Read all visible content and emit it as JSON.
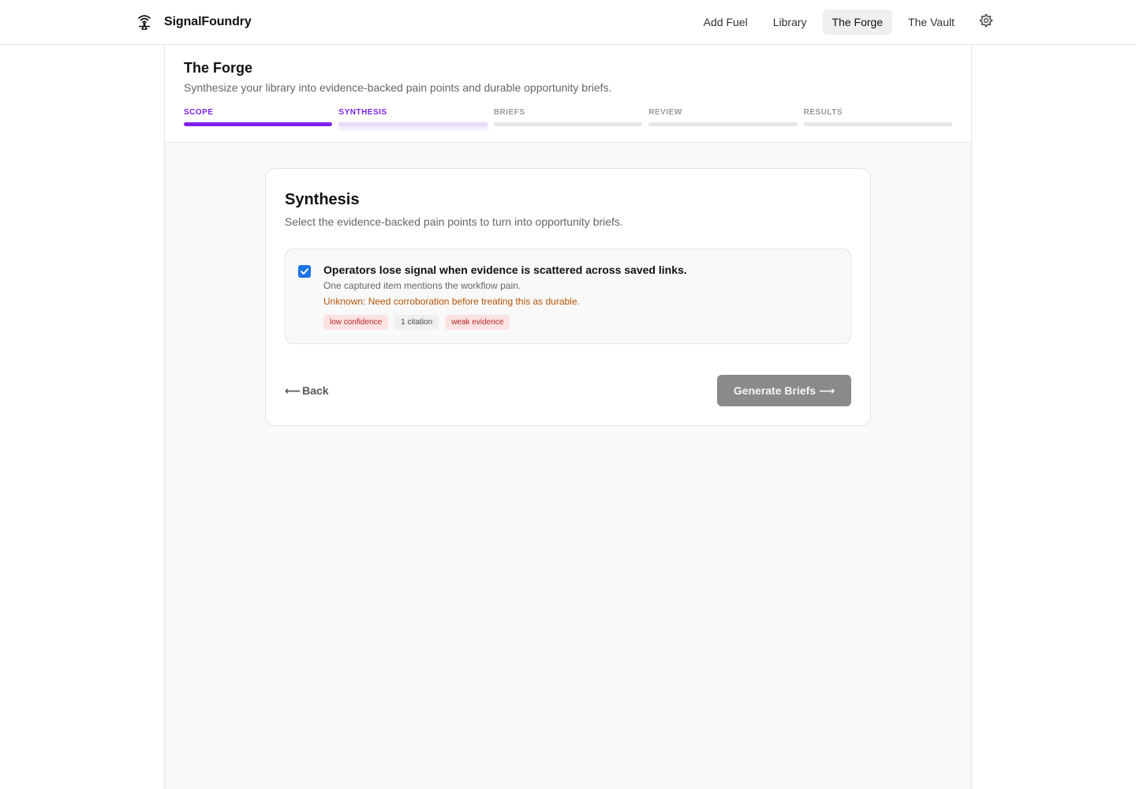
{
  "brand": {
    "name": "SignalFoundry",
    "icon": "signal-tower-icon"
  },
  "nav": {
    "items": [
      {
        "label": "Add Fuel",
        "active": false
      },
      {
        "label": "Library",
        "active": false
      },
      {
        "label": "The Forge",
        "active": true
      },
      {
        "label": "The Vault",
        "active": false
      }
    ],
    "settings_icon": "gear-icon"
  },
  "page": {
    "title": "The Forge",
    "subtitle": "Synthesize your library into evidence-backed pain points and durable opportunity briefs."
  },
  "steps": [
    {
      "label": "SCOPE",
      "state": "done"
    },
    {
      "label": "SYNTHESIS",
      "state": "current"
    },
    {
      "label": "BRIEFS",
      "state": "pending"
    },
    {
      "label": "REVIEW",
      "state": "pending"
    },
    {
      "label": "RESULTS",
      "state": "pending"
    }
  ],
  "card": {
    "title": "Synthesis",
    "subtitle": "Select the evidence-backed pain points to turn into opportunity briefs.",
    "pain_points": [
      {
        "checked": true,
        "title": "Operators lose signal when evidence is scattered across saved links.",
        "description": "One captured item mentions the workflow pain.",
        "unknown": "Unknown: Need corroboration before treating this as durable.",
        "tags": [
          "low confidence",
          "1 citation",
          "weak evidence"
        ]
      }
    ],
    "back_label": "Back",
    "back_arrow": "⟵",
    "primary_label": "Generate Briefs",
    "primary_arrow": "⟶"
  },
  "colors": {
    "accent": "#7c22e8",
    "checkbox": "#1a73e8",
    "warning_text": "#b45309",
    "tag_red_bg": "#fde2e2",
    "tag_red_text": "#b3262a",
    "disabled_button": "#8a8a8a"
  }
}
